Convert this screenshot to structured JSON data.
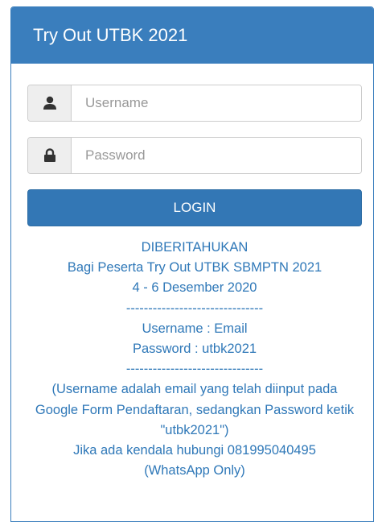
{
  "panel": {
    "title": "Try Out UTBK 2021"
  },
  "form": {
    "username_placeholder": "Username",
    "password_placeholder": "Password",
    "username_icon": "user-icon",
    "password_icon": "lock-icon",
    "login_label": "LOGIN"
  },
  "notice": {
    "lines": [
      "DIBERITAHUKAN",
      "Bagi Peserta Try Out UTBK SBMPTN 2021",
      "4 - 6 Desember 2020",
      "-------------------------------",
      "Username : Email",
      "Password : utbk2021",
      "-------------------------------",
      "(Username adalah email yang telah diinput pada Google Form Pendaftaran, sedangkan Password ketik \"utbk2021\")",
      "Jika ada kendala hubungi 081995040495",
      "(WhatsApp Only)"
    ]
  },
  "colors": {
    "primary": "#3a7ebd",
    "notice_text": "#2f78b8",
    "addon_bg": "#eeeeee"
  }
}
